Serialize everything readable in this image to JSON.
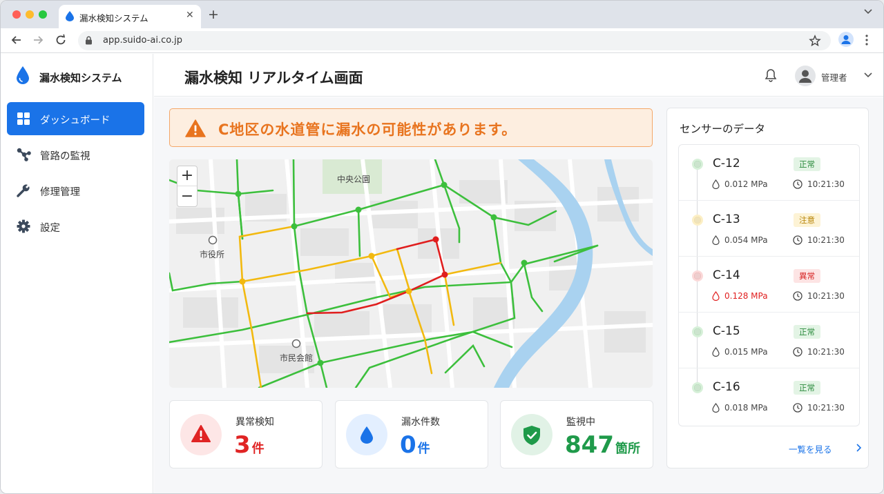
{
  "browser": {
    "tab_title": "漏水検知システム",
    "url": "app.suido-ai.co.jp"
  },
  "app": {
    "brand": "漏水検知システム",
    "page_title": "漏水検知 リアルタイム画面",
    "user_name": "管理者"
  },
  "sidebar": {
    "items": [
      {
        "label": "ダッシュボード",
        "icon": "dashboard-grid-icon",
        "active": true
      },
      {
        "label": "管路の監視",
        "icon": "pipe-network-icon",
        "active": false
      },
      {
        "label": "修理管理",
        "icon": "wrench-icon",
        "active": false
      },
      {
        "label": "設定",
        "icon": "gear-icon",
        "active": false
      }
    ]
  },
  "alert": {
    "text": "C地区の水道管に漏水の可能性があります。",
    "color": "#e8741f"
  },
  "map": {
    "labels": {
      "park": "中央公園",
      "city_hall": "市役所",
      "civic_hall": "市民会館"
    },
    "zoom_in": "+",
    "zoom_out": "−",
    "pipe_colors": {
      "normal": "#3cbf3c",
      "caution": "#f2b90f",
      "leak": "#e01e1e"
    }
  },
  "stats": [
    {
      "label": "異常検知",
      "value": "3",
      "unit": "件",
      "color": "#e02424",
      "icon": "warning-icon"
    },
    {
      "label": "漏水件数",
      "value": "0",
      "unit": "件",
      "color": "#1a73e8",
      "icon": "water-drop-icon"
    },
    {
      "label": "監視中",
      "value": "847",
      "unit": "箇所",
      "color": "#1f9a4a",
      "icon": "shield-check-icon"
    }
  ],
  "sensor_panel": {
    "title": "センサーのデータ",
    "view_all": "一覧を見る",
    "sensors": [
      {
        "id": "C-12",
        "status": "正常",
        "level": "normal",
        "pressure": "0.012 MPa",
        "time": "10:21:30"
      },
      {
        "id": "C-13",
        "status": "注意",
        "level": "caution",
        "pressure": "0.054 MPa",
        "time": "10:21:30"
      },
      {
        "id": "C-14",
        "status": "異常",
        "level": "alert",
        "pressure": "0.128 MPa",
        "time": "10:21:30"
      },
      {
        "id": "C-15",
        "status": "正常",
        "level": "normal",
        "pressure": "0.015 MPa",
        "time": "10:21:30"
      },
      {
        "id": "C-16",
        "status": "正常",
        "level": "normal",
        "pressure": "0.018 MPa",
        "time": "10:21:30"
      }
    ]
  }
}
